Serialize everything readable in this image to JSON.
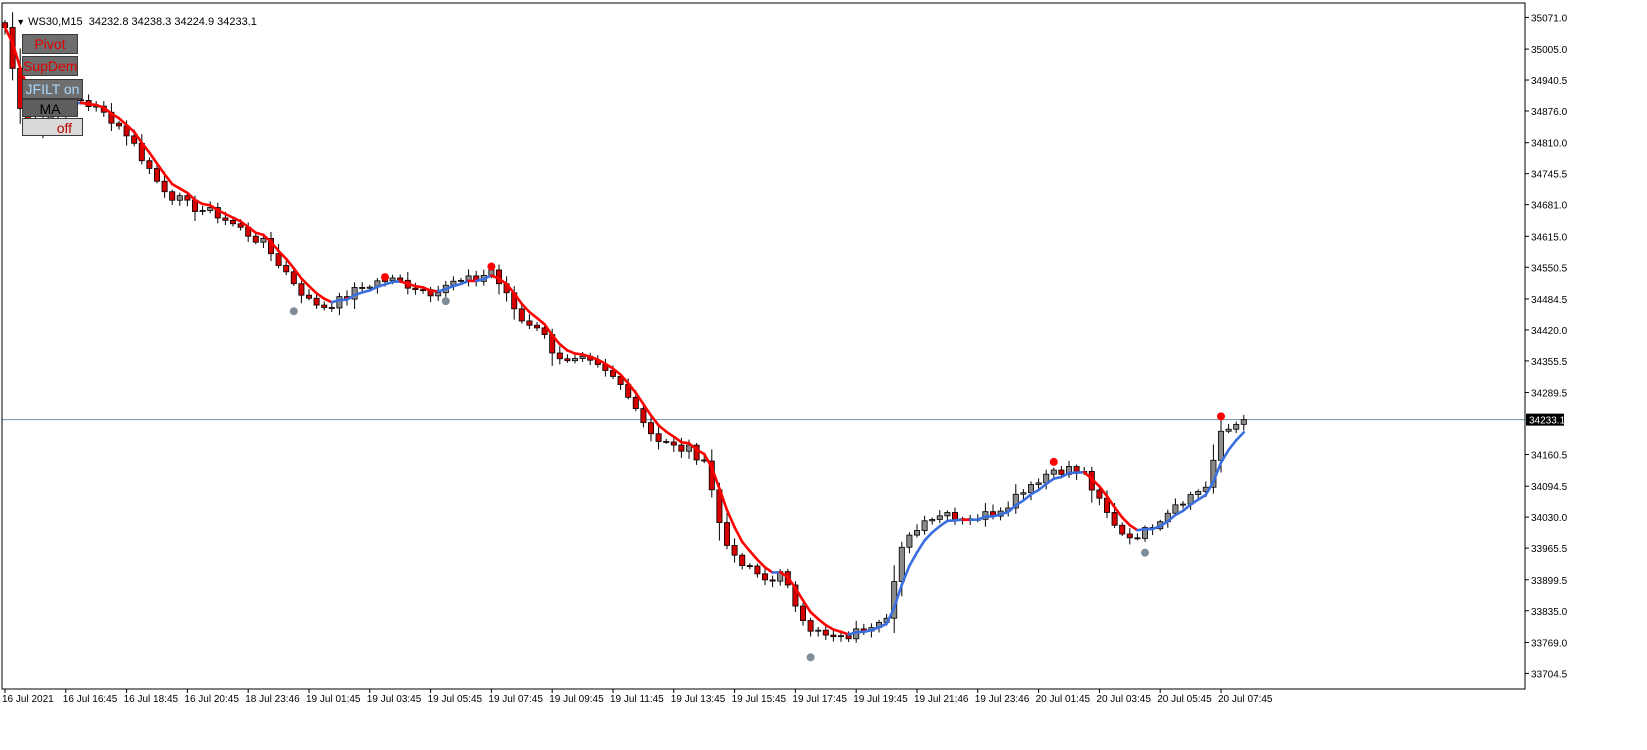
{
  "header": {
    "symbol": "WS30,M15",
    "ohlc": "34232.8 34238.3 34224.9 34233.1"
  },
  "buttons": {
    "pivot": "Pivot",
    "supdem": "SupDem",
    "jfilt": "JFILT on",
    "ma": "MA",
    "off": "off"
  },
  "colors": {
    "bull": "#8a8a8a",
    "bear": "#d40000",
    "line_down": "#ff0000",
    "line_up": "#3b6fe0",
    "pivot_high": "#ff0000",
    "pivot_low": "#7f8c99",
    "bid_line": "#6f8fa6",
    "price_tag_bg": "#000000"
  },
  "chart_data": {
    "type": "candlestick",
    "symbol": "WS30",
    "timeframe": "M15",
    "ylim": [
      33672,
      35101
    ],
    "y_ticks": [
      35071.0,
      35005.0,
      34940.5,
      34876.0,
      34810.0,
      34745.5,
      34681.0,
      34615.0,
      34550.5,
      34484.5,
      34420.0,
      34355.5,
      34289.5,
      34160.5,
      34094.5,
      34030.0,
      33965.5,
      33899.5,
      33835.0,
      33769.0,
      33704.5
    ],
    "x_ticks": [
      {
        "i": 0,
        "label": "16 Jul 2021"
      },
      {
        "i": 8,
        "label": "16 Jul 16:45"
      },
      {
        "i": 16,
        "label": "16 Jul 18:45"
      },
      {
        "i": 24,
        "label": "16 Jul 20:45"
      },
      {
        "i": 32,
        "label": "18 Jul 23:46"
      },
      {
        "i": 40,
        "label": "19 Jul 01:45"
      },
      {
        "i": 48,
        "label": "19 Jul 03:45"
      },
      {
        "i": 56,
        "label": "19 Jul 05:45"
      },
      {
        "i": 64,
        "label": "19 Jul 07:45"
      },
      {
        "i": 72,
        "label": "19 Jul 09:45"
      },
      {
        "i": 80,
        "label": "19 Jul 11:45"
      },
      {
        "i": 88,
        "label": "19 Jul 13:45"
      },
      {
        "i": 96,
        "label": "19 Jul 15:45"
      },
      {
        "i": 104,
        "label": "19 Jul 17:45"
      },
      {
        "i": 112,
        "label": "19 Jul 19:45"
      },
      {
        "i": 120,
        "label": "19 Jul 21:46"
      },
      {
        "i": 128,
        "label": "19 Jul 23:46"
      },
      {
        "i": 136,
        "label": "20 Jul 01:45"
      },
      {
        "i": 144,
        "label": "20 Jul 03:45"
      },
      {
        "i": 152,
        "label": "20 Jul 05:45"
      },
      {
        "i": 160,
        "label": "20 Jul 07:45"
      }
    ],
    "current_price": 34233.1,
    "current_price_label": "34233.1",
    "bar_count": 164,
    "close_anchors": [
      [
        0,
        35050
      ],
      [
        2,
        34880
      ],
      [
        4,
        34840
      ],
      [
        6,
        34870
      ],
      [
        8,
        34895
      ],
      [
        10,
        34900
      ],
      [
        12,
        34880
      ],
      [
        14,
        34860
      ],
      [
        16,
        34830
      ],
      [
        18,
        34780
      ],
      [
        20,
        34730
      ],
      [
        22,
        34700
      ],
      [
        24,
        34680
      ],
      [
        26,
        34670
      ],
      [
        28,
        34660
      ],
      [
        30,
        34640
      ],
      [
        32,
        34620
      ],
      [
        34,
        34600
      ],
      [
        36,
        34560
      ],
      [
        38,
        34520
      ],
      [
        40,
        34480
      ],
      [
        42,
        34470
      ],
      [
        44,
        34480
      ],
      [
        46,
        34500
      ],
      [
        48,
        34515
      ],
      [
        50,
        34525
      ],
      [
        52,
        34520
      ],
      [
        54,
        34510
      ],
      [
        56,
        34500
      ],
      [
        58,
        34515
      ],
      [
        60,
        34520
      ],
      [
        62,
        34525
      ],
      [
        64,
        34545
      ],
      [
        66,
        34490
      ],
      [
        68,
        34440
      ],
      [
        70,
        34430
      ],
      [
        72,
        34380
      ],
      [
        74,
        34350
      ],
      [
        76,
        34355
      ],
      [
        78,
        34340
      ],
      [
        80,
        34320
      ],
      [
        82,
        34290
      ],
      [
        84,
        34230
      ],
      [
        86,
        34190
      ],
      [
        88,
        34175
      ],
      [
        90,
        34170
      ],
      [
        92,
        34150
      ],
      [
        94,
        34020
      ],
      [
        96,
        33940
      ],
      [
        98,
        33920
      ],
      [
        100,
        33900
      ],
      [
        102,
        33910
      ],
      [
        104,
        33850
      ],
      [
        106,
        33800
      ],
      [
        108,
        33780
      ],
      [
        110,
        33775
      ],
      [
        112,
        33790
      ],
      [
        114,
        33810
      ],
      [
        116,
        33830
      ],
      [
        118,
        33960
      ],
      [
        120,
        34010
      ],
      [
        122,
        34035
      ],
      [
        124,
        34040
      ],
      [
        126,
        34030
      ],
      [
        128,
        34030
      ],
      [
        130,
        34040
      ],
      [
        132,
        34060
      ],
      [
        134,
        34090
      ],
      [
        136,
        34110
      ],
      [
        138,
        34130
      ],
      [
        140,
        34130
      ],
      [
        142,
        34120
      ],
      [
        144,
        34060
      ],
      [
        146,
        34010
      ],
      [
        148,
        33990
      ],
      [
        150,
        34000
      ],
      [
        152,
        34030
      ],
      [
        154,
        34060
      ],
      [
        156,
        34075
      ],
      [
        158,
        34095
      ],
      [
        160,
        34200
      ],
      [
        162,
        34225
      ],
      [
        163,
        34233.1
      ]
    ],
    "pivot_highs": [
      {
        "i": 50,
        "price": 34530
      },
      {
        "i": 64,
        "price": 34552
      },
      {
        "i": 138,
        "price": 34145
      },
      {
        "i": 160,
        "price": 34240
      }
    ],
    "pivot_lows": [
      {
        "i": 38,
        "price": 34459
      },
      {
        "i": 58,
        "price": 34480
      },
      {
        "i": 106,
        "price": 33738
      },
      {
        "i": 150,
        "price": 33956
      }
    ]
  }
}
